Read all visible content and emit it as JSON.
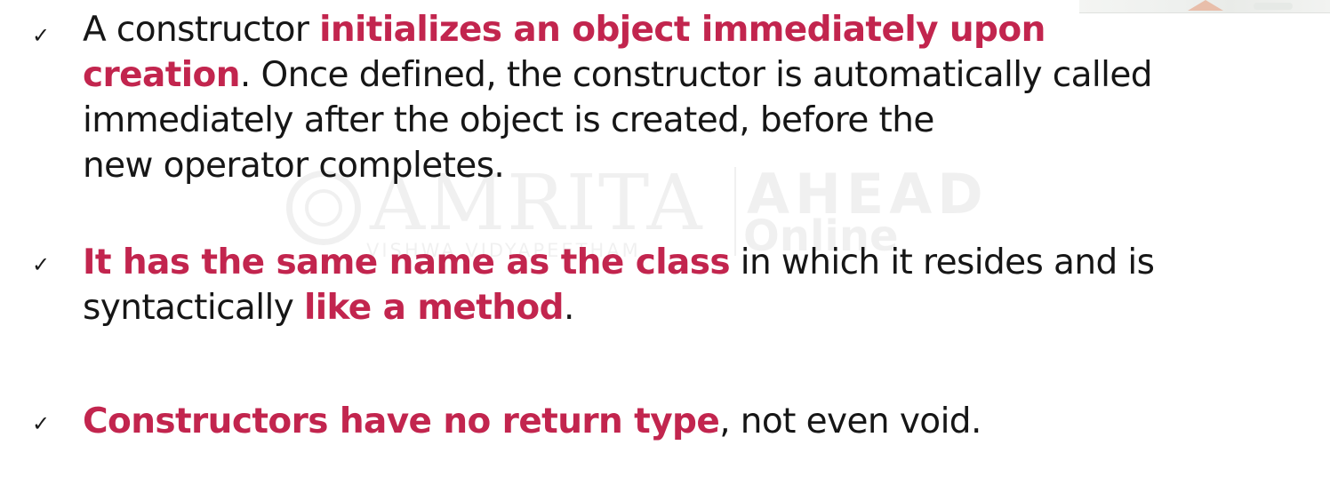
{
  "watermark": {
    "name": "AMRITA",
    "subtitle": "VISHWA VIDYAPEETHAM",
    "brand": "AHEAD",
    "brand_sub": "Online"
  },
  "bullet_marker": "✓",
  "bullets": [
    {
      "lines": [
        {
          "a": "A constructor ",
          "b": "initializes an object immediately upon",
          "c": ""
        },
        {
          "a": "",
          "b": "creation",
          "c": ". Once defined, the constructor is automatically called"
        },
        {
          "a": "immediately after the object is created, before the",
          "b": "",
          "c": ""
        },
        {
          "a": "new operator completes.",
          "b": "",
          "c": ""
        }
      ]
    },
    {
      "lines": [
        {
          "a": "",
          "b": "It has the same name as the class",
          "c": " in which it resides and is"
        },
        {
          "a": "syntactically ",
          "b": "like a method",
          "c": "."
        }
      ]
    },
    {
      "lines": [
        {
          "a": "",
          "b": "Constructors have no return type",
          "c": ", not even void."
        }
      ]
    }
  ],
  "colors": {
    "highlight": "#c2254e",
    "text": "#161616"
  }
}
